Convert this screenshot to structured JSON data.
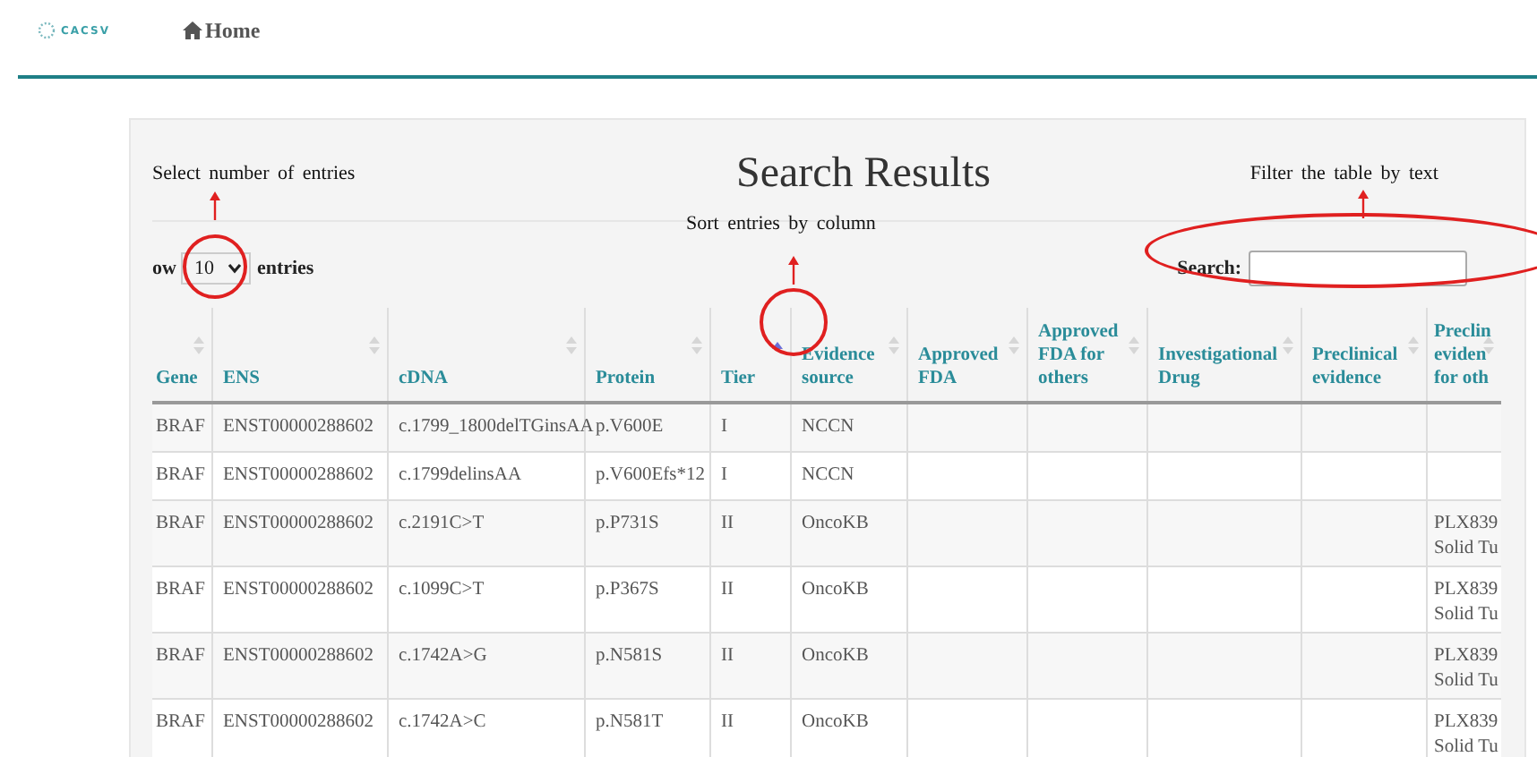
{
  "navbar": {
    "logo": "CACSV",
    "home_link": "Home"
  },
  "panel": {
    "title": "Search Results",
    "length_control": {
      "prefix": "ow",
      "value": "10",
      "suffix": "entries"
    },
    "search": {
      "label": "Search:"
    }
  },
  "annotations": [
    {
      "kind": "select",
      "text": "Select number of entries"
    },
    {
      "kind": "sort",
      "text": "Sort entries by column"
    },
    {
      "kind": "filter",
      "text": "Filter the table by text"
    }
  ],
  "table": {
    "columns": [
      {
        "label": "Gene",
        "sorted": false
      },
      {
        "label": "ENS",
        "sorted": false
      },
      {
        "label": "cDNA",
        "sorted": false
      },
      {
        "label": "Protein",
        "sorted": false
      },
      {
        "label": "Tier",
        "sorted": true
      },
      {
        "label": "Evidence\nsource",
        "sorted": false
      },
      {
        "label": "Approved\nFDA",
        "sorted": false
      },
      {
        "label": "Approved\nFDA for\nothers",
        "sorted": false
      },
      {
        "label": "Investigational\nDrug",
        "sorted": false
      },
      {
        "label": "Preclinical\nevidence",
        "sorted": false
      },
      {
        "label": "Preclin\neviden\nfor oth",
        "sorted": false
      }
    ],
    "rows": [
      [
        "BRAF",
        "ENST00000288602",
        "c.1799_1800delTGinsAA",
        "p.V600E",
        "I",
        "NCCN",
        "",
        "",
        "",
        "",
        ""
      ],
      [
        "BRAF",
        "ENST00000288602",
        "c.1799delinsAA",
        "p.V600Efs*12",
        "I",
        "NCCN",
        "",
        "",
        "",
        "",
        ""
      ],
      [
        "BRAF",
        "ENST00000288602",
        "c.2191C>T",
        "p.P731S",
        "II",
        "OncoKB",
        "",
        "",
        "",
        "",
        "PLX839\nSolid Tu"
      ],
      [
        "BRAF",
        "ENST00000288602",
        "c.1099C>T",
        "p.P367S",
        "II",
        "OncoKB",
        "",
        "",
        "",
        "",
        "PLX839\nSolid Tu"
      ],
      [
        "BRAF",
        "ENST00000288602",
        "c.1742A>G",
        "p.N581S",
        "II",
        "OncoKB",
        "",
        "",
        "",
        "",
        "PLX839\nSolid Tu"
      ],
      [
        "BRAF",
        "ENST00000288602",
        "c.1742A>C",
        "p.N581T",
        "II",
        "OncoKB",
        "",
        "",
        "",
        "",
        "PLX839\nSolid Tu"
      ]
    ]
  }
}
